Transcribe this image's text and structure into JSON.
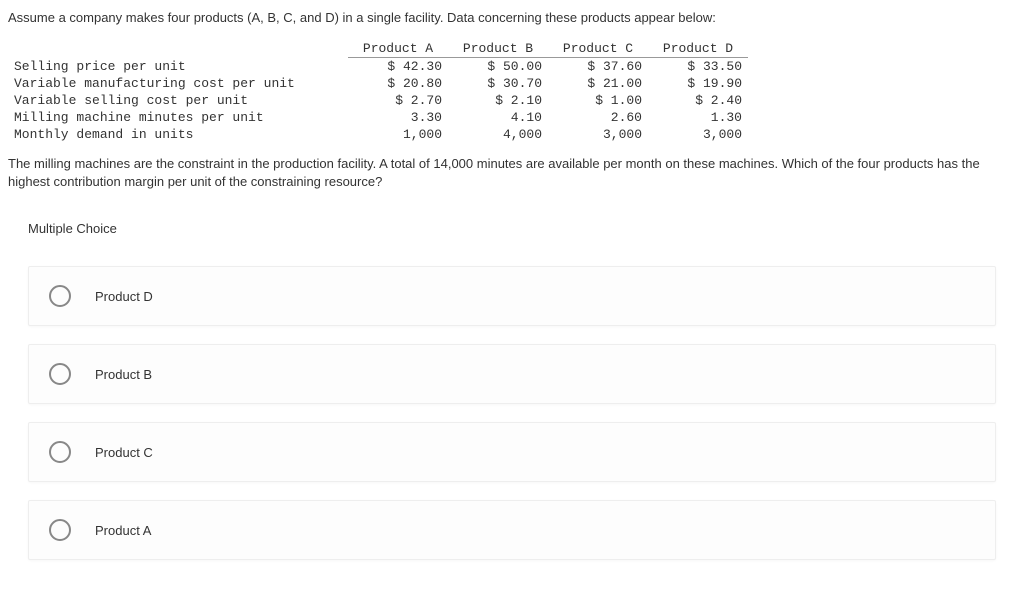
{
  "intro": "Assume a company makes four products (A, B, C, and D) in a single facility. Data concerning these products appear below:",
  "table": {
    "headers": [
      "",
      "Product A",
      "Product B",
      "Product C",
      "Product D"
    ],
    "rows": [
      {
        "label": "Selling price per unit",
        "a": "$ 42.30",
        "b": "$ 50.00",
        "c": "$ 37.60",
        "d": "$ 33.50"
      },
      {
        "label": "Variable manufacturing cost per unit",
        "a": "$ 20.80",
        "b": "$ 30.70",
        "c": "$ 21.00",
        "d": "$ 19.90"
      },
      {
        "label": "Variable selling cost per unit",
        "a": "$ 2.70",
        "b": "$ 2.10",
        "c": "$ 1.00",
        "d": "$ 2.40"
      },
      {
        "label": "Milling machine minutes per unit",
        "a": "3.30",
        "b": "4.10",
        "c": "2.60",
        "d": "1.30"
      },
      {
        "label": "Monthly demand in units",
        "a": "1,000",
        "b": "4,000",
        "c": "3,000",
        "d": "3,000"
      }
    ]
  },
  "question": "The milling machines are the constraint in the production facility. A total of 14,000 minutes are available per month on these machines. Which of the four products has the highest contribution margin per unit of the constraining resource?",
  "mc_label": "Multiple Choice",
  "options": [
    {
      "label": "Product D"
    },
    {
      "label": "Product B"
    },
    {
      "label": "Product C"
    },
    {
      "label": "Product A"
    }
  ]
}
